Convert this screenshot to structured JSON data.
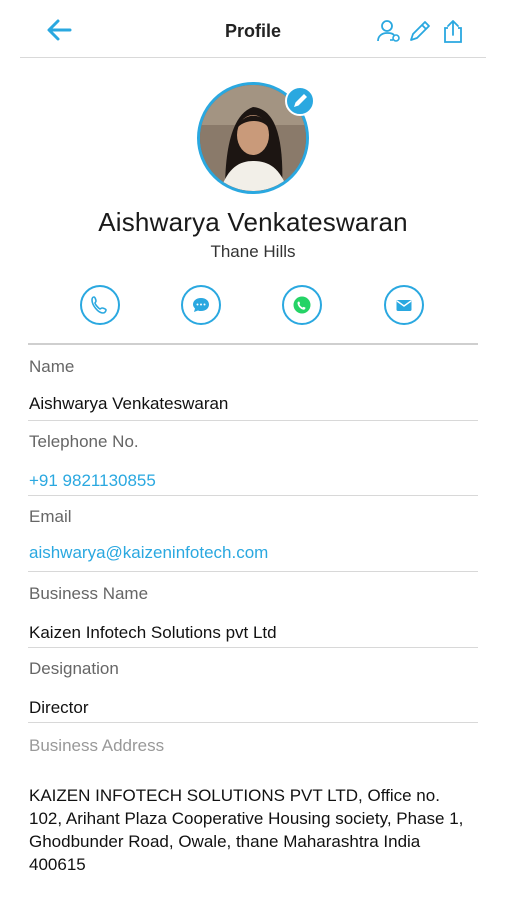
{
  "header": {
    "title": "Profile",
    "icons": [
      "back-arrow-icon",
      "contact-link-icon",
      "edit-icon",
      "share-icon"
    ]
  },
  "profile": {
    "name": "Aishwarya Venkateswaran",
    "location": "Thane Hills"
  },
  "actions": [
    "phone-icon",
    "chat-icon",
    "whatsapp-icon",
    "mail-icon"
  ],
  "fields": {
    "name": {
      "label": "Name",
      "value": "Aishwarya Venkateswaran"
    },
    "telephone": {
      "label": "Telephone No.",
      "value": "+91 9821130855"
    },
    "email": {
      "label": "Email",
      "value": "aishwarya@kaizeninfotech.com"
    },
    "business_name": {
      "label": "Business Name",
      "value": "Kaizen Infotech Solutions pvt Ltd"
    },
    "designation": {
      "label": "Designation",
      "value": "Director"
    },
    "business_address": {
      "label": "Business Address",
      "value": "KAIZEN INFOTECH SOLUTIONS PVT LTD, Office no. 102, Arihant Plaza Cooperative Housing society, Phase 1, Ghodbunder Road, Owale, thane Maharashtra India 400615"
    }
  },
  "colors": {
    "accent": "#2aa8e0",
    "whatsapp": "#25d366"
  }
}
